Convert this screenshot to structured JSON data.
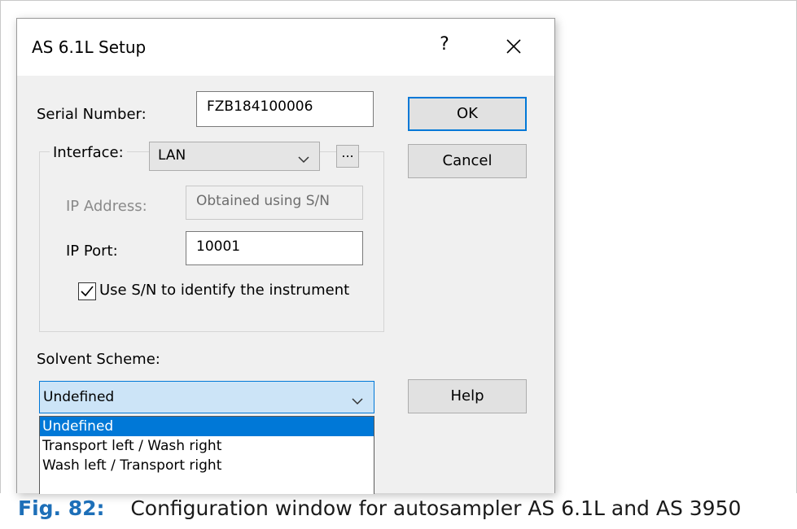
{
  "window": {
    "title": "AS 6.1L Setup",
    "help_glyph": "?",
    "close_glyph": "✕"
  },
  "serial": {
    "label": "Serial Number:",
    "value": "FZB184100006"
  },
  "buttons": {
    "ok": "OK",
    "cancel": "Cancel",
    "help": "Help",
    "browse": "..."
  },
  "interface": {
    "label": "Interface:",
    "value": "LAN"
  },
  "ip_address": {
    "label": "IP Address:",
    "value": "Obtained using S/N"
  },
  "ip_port": {
    "label": "IP Port:",
    "value": "10001"
  },
  "use_sn": {
    "label": "Use S/N to identify the instrument",
    "checked": true
  },
  "solvent_scheme": {
    "label": "Solvent Scheme:",
    "value": "Undefined",
    "options": [
      "Undefined",
      "Transport left / Wash right",
      "Wash left / Transport right"
    ],
    "selected_index": 0
  },
  "caption": {
    "figure": "Fig. 82:",
    "text": "Configuration window for autosampler AS 6.1L and AS 3950"
  },
  "colors": {
    "accent": "#0078d7",
    "caption_blue": "#1d6fb8"
  }
}
